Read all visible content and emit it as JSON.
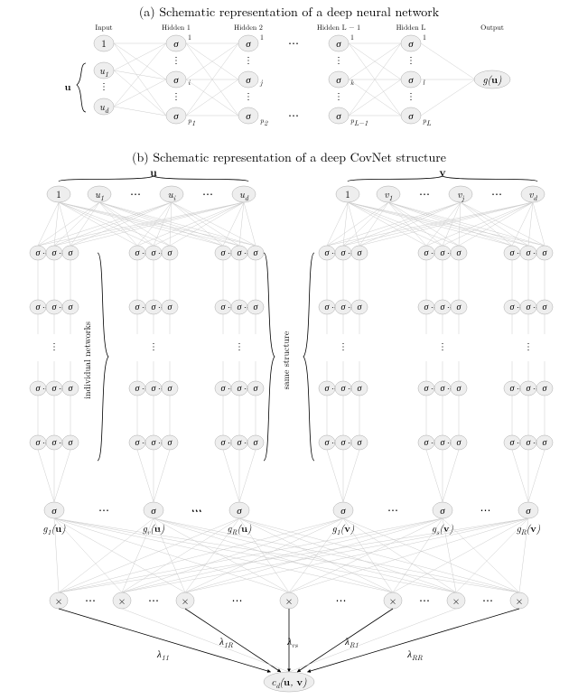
{
  "panelA": {
    "title": "(a) Schematic representation of a deep neural network",
    "colLabels": [
      "Input",
      "Hidden 1",
      "Hidden 2",
      "Hidden L − 1",
      "Hidden L",
      "Output"
    ],
    "inputBrace": "u",
    "inputNodes": [
      "1",
      "u₁",
      "u_d"
    ],
    "sigma": "σ",
    "superscripts": [
      "1",
      "1",
      "1",
      "1"
    ],
    "subLabels": [
      "i",
      "j",
      "k",
      "l"
    ],
    "bottomSubs": [
      "p₁",
      "p₂",
      "p_{L−1}",
      "p_L"
    ],
    "outputLabel": "g(u)",
    "dots": "⋯"
  },
  "panelB": {
    "title": "(b) Schematic representation of a deep CovNet structure",
    "uHeader": "u",
    "vHeader": "v",
    "uNodes": [
      "1",
      "u₁",
      "u_i",
      "u_d"
    ],
    "vNodes": [
      "1",
      "v₁",
      "v_j",
      "v_d"
    ],
    "sigma": "σ",
    "times": "×",
    "sideLabelLeft": "individual networks",
    "sideLabelRight": "same structure",
    "gLabelsU": [
      "g₁(u)",
      "g_r(u)",
      "g_R(u)"
    ],
    "gLabelsV": [
      "g₁(v)",
      "g_s(v)",
      "g_R(v)"
    ],
    "lambdaLabels": [
      "λ₁₁",
      "λ₁R",
      "λ_rs",
      "λ_R1",
      "λ_RR"
    ],
    "output": "c_d(u, v)",
    "dots": "⋯",
    "vdots": "⋮"
  }
}
